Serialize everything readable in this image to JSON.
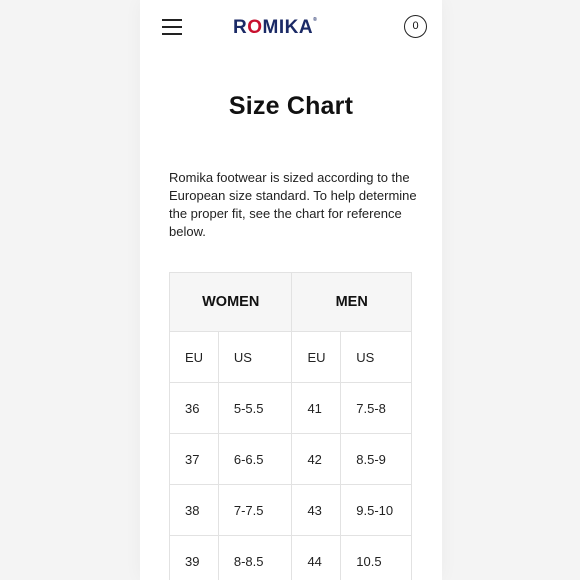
{
  "header": {
    "logo_main": "ROMIKA",
    "logo_mark": "®",
    "cart_count": "0"
  },
  "page": {
    "title": "Size Chart",
    "intro": "Romika footwear is sized according to the European size standard. To help determine the proper fit, see the chart for reference below."
  },
  "table": {
    "groups": [
      "WOMEN",
      "MEN"
    ],
    "subheaders": [
      "EU",
      "US",
      "EU",
      "US"
    ],
    "rows": [
      [
        "36",
        "5-5.5",
        "41",
        "7.5-8"
      ],
      [
        "37",
        "6-6.5",
        "42",
        "8.5-9"
      ],
      [
        "38",
        "7-7.5",
        "43",
        "9.5-10"
      ],
      [
        "39",
        "8-8.5",
        "44",
        "10.5"
      ]
    ]
  },
  "colors": {
    "logo_navy": "#1b2a66",
    "logo_red": "#c8102e",
    "header_bg": "#f6f6f6",
    "border": "#e2e2e2"
  }
}
